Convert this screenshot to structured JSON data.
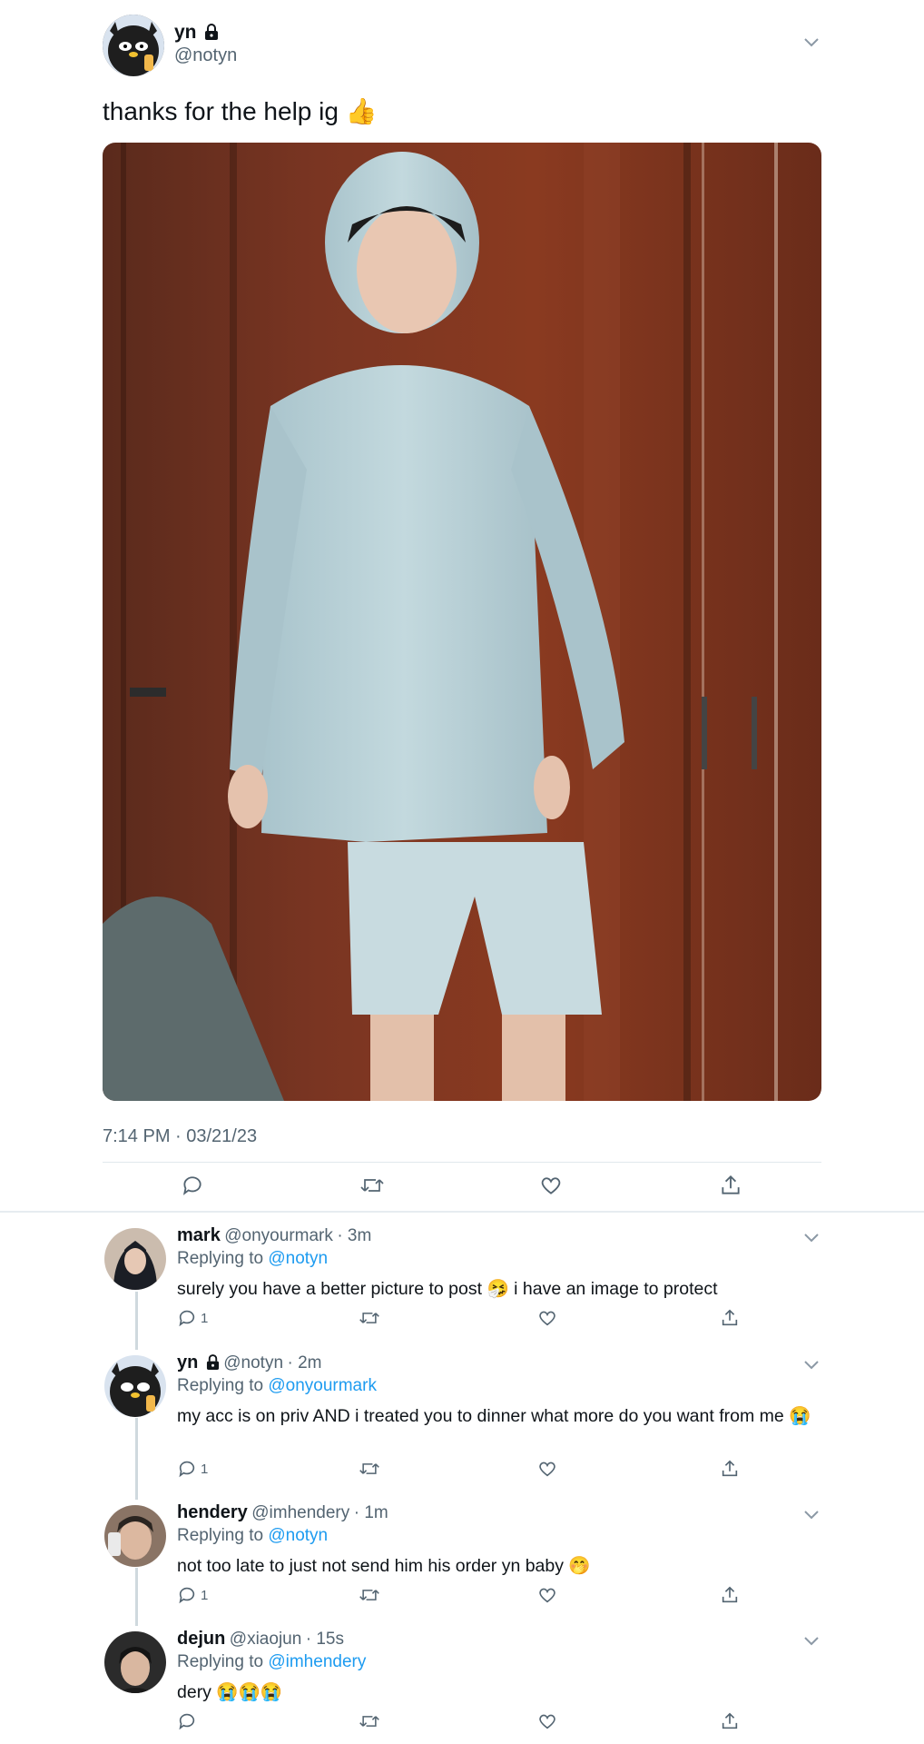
{
  "main": {
    "name": "yn",
    "handle": "@notyn",
    "text": "thanks for the help ig 👍",
    "timestamp": "7:14 PM · 03/21/23"
  },
  "replies": [
    {
      "name": "mark",
      "handle": "@onyourmark",
      "time": "· 3m",
      "replying_prefix": "Replying to ",
      "replying_to": "@notyn",
      "text": "surely you have a better picture to post 🤧 i have an image to protect",
      "reply_count": "1",
      "locked": false
    },
    {
      "name": "yn",
      "handle": "@notyn",
      "time": "· 2m",
      "replying_prefix": "Replying to ",
      "replying_to": "@onyourmark",
      "text": "my acc is on priv AND i treated you to dinner what more do you want from me 😭",
      "reply_count": "1",
      "locked": true
    },
    {
      "name": "hendery",
      "handle": "@imhendery",
      "time": "· 1m",
      "replying_prefix": "Replying to ",
      "replying_to": "@notyn",
      "text": "not too late to just not send him his order yn baby 🤭",
      "reply_count": "1",
      "locked": false
    },
    {
      "name": "dejun",
      "handle": "@xiaojun",
      "time": "· 15s",
      "replying_prefix": "Replying to ",
      "replying_to": "@imhendery",
      "text": "dery 😭😭😭",
      "reply_count": "",
      "locked": false
    }
  ],
  "icons": {
    "reply": "speech-bubble-icon",
    "retweet": "retweet-icon",
    "like": "heart-icon",
    "share": "share-icon",
    "more": "chevron-down-icon",
    "lock": "lock-icon"
  },
  "colors": {
    "link": "#1d9bf0",
    "secondary_text": "#536471",
    "primary_text": "#0f1419"
  }
}
